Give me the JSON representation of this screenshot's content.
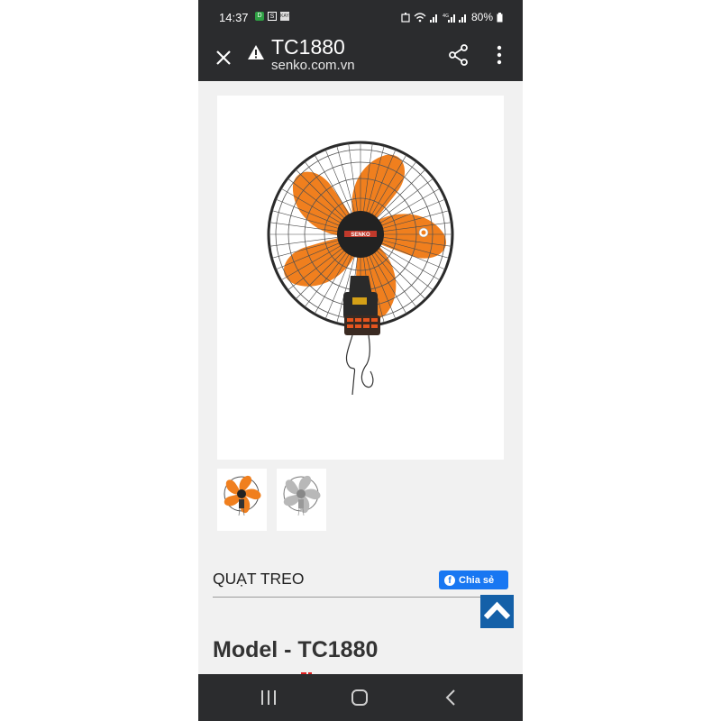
{
  "status_bar": {
    "time": "14:37",
    "notification_icons": [
      "D",
      "S",
      "KAY"
    ],
    "battery_percent": "80%"
  },
  "toolbar": {
    "title": "TC1880",
    "url": "senko.com.vn"
  },
  "product": {
    "brand_label": "SENKO",
    "section_heading": "QUẠT TREO",
    "share_label": "Chia sẻ",
    "model": "Model - TC1880",
    "thumbnails": [
      "orange-fan",
      "grey-fan"
    ]
  },
  "colors": {
    "bar_bg": "#2b2c2e",
    "page_bg": "#f1f1f1",
    "fan_orange": "#f07f1e",
    "facebook_blue": "#1877f2",
    "scroll_top_blue": "#1460a8"
  }
}
